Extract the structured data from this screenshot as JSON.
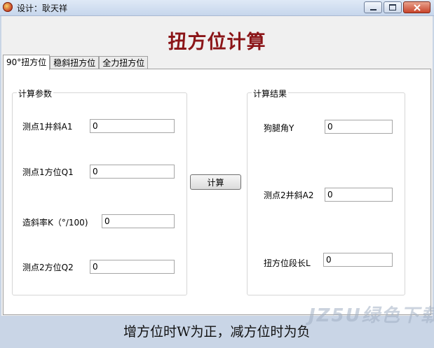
{
  "window": {
    "title": "设计：耿天祥"
  },
  "app": {
    "title": "扭方位计算"
  },
  "tabs": [
    {
      "label": "90°扭方位"
    },
    {
      "label": "稳斜扭方位"
    },
    {
      "label": "全力扭方位"
    }
  ],
  "params": {
    "title": "计算参数",
    "fields": [
      {
        "label": "测点1井斜A1",
        "value": "0"
      },
      {
        "label": "测点1方位Q1",
        "value": "0"
      },
      {
        "label": "造斜率K（°/100)",
        "value": "0"
      },
      {
        "label": "测点2方位Q2",
        "value": "0"
      }
    ]
  },
  "results": {
    "title": "计算结果",
    "fields": [
      {
        "label": "狗腿角Y",
        "value": "0"
      },
      {
        "label": "测点2井斜A2",
        "value": "0"
      },
      {
        "label": "扭方位段长L",
        "value": "0"
      }
    ]
  },
  "actions": {
    "calculate_label": "计算"
  },
  "footer": {
    "note": "增方位时W为正，减方位时为负"
  },
  "watermark": {
    "text": "JZ5U绿色下载"
  }
}
